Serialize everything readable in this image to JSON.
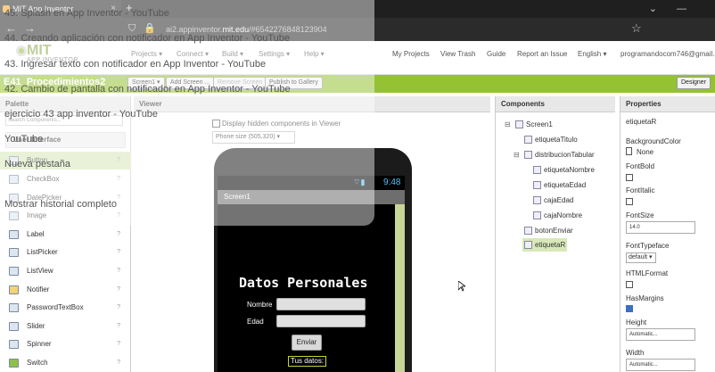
{
  "browser": {
    "tab_title": "MIT App Inventor",
    "new_tab": "+",
    "url_host": "ai2.appinventor.",
    "url_bold": "mit.edu",
    "url_path": "/#6542276848123904"
  },
  "app": {
    "logo_text": "MIT",
    "logo_sub": "APP INVENTOR",
    "menus": [
      "Projects ▾",
      "Connect ▾",
      "Build ▾",
      "Settings ▾",
      "Help ▾"
    ],
    "right_menus": [
      "My Projects",
      "View Trash",
      "Guide",
      "Report an Issue",
      "English ▾",
      "programandocom746@gmail.com ▾"
    ],
    "project_title": "E41_Procedimientos2",
    "screen_select": "Screen1 ▾",
    "buttons": [
      "Add Screen ...",
      "Remove Screen",
      "Publish to Gallery"
    ],
    "designer": "Designer"
  },
  "palette": {
    "header": "Palette",
    "search_placeholder": "Search Components...",
    "section": "User Interface",
    "items": [
      "Button",
      "CheckBox",
      "DatePicker",
      "Image",
      "Label",
      "ListPicker",
      "ListView",
      "Notifier",
      "PasswordTextBox",
      "Slider",
      "Spinner",
      "Switch"
    ]
  },
  "viewer": {
    "header": "Viewer",
    "hidden_label": "Display hidden components in Viewer",
    "phone_size": "Phone size (505,320) ▾",
    "time": "9:48",
    "screen_name": "Screen1",
    "title": "Datos Personales",
    "nombre": "Nombre",
    "edad": "Edad",
    "enviar": "Enviar",
    "tus_datos": "Tus datos:"
  },
  "components": {
    "header": "Components",
    "items": [
      "Screen1",
      "etiquetaTitulo",
      "distribucionTabular",
      "etiquetaNombre",
      "etiquetaEdad",
      "cajaEdad",
      "cajaNombre",
      "botonEnviar",
      "etiquetaR"
    ]
  },
  "properties": {
    "header": "Properties",
    "component": "etiquetaR",
    "bg_label": "BackgroundColor",
    "bg_value": "None",
    "font_bold": "FontBold",
    "font_italic": "FontItalic",
    "font_size": "FontSize",
    "font_size_value": "14.0",
    "font_typeface": "FontTypeface",
    "font_typeface_value": "default ▾",
    "html_format": "HTMLFormat",
    "has_margins": "HasMargins",
    "height": "Height",
    "height_value": "Automatic...",
    "width": "Width",
    "width_value": "Automatic..."
  },
  "overlay": {
    "history": [
      "45. Splash en App Inventor - YouTube",
      "44. Creando aplicación con notificador en App Inventor - YouTube",
      "43. Ingresar texto con notificador en App Inventor - YouTube",
      "42. Cambio de pantalla con notificador en App Inventor - YouTube",
      "ejercicio 43 app inventor - YouTube",
      "YouTube",
      "Nueva pestaña",
      "Mostrar historial completo"
    ]
  }
}
